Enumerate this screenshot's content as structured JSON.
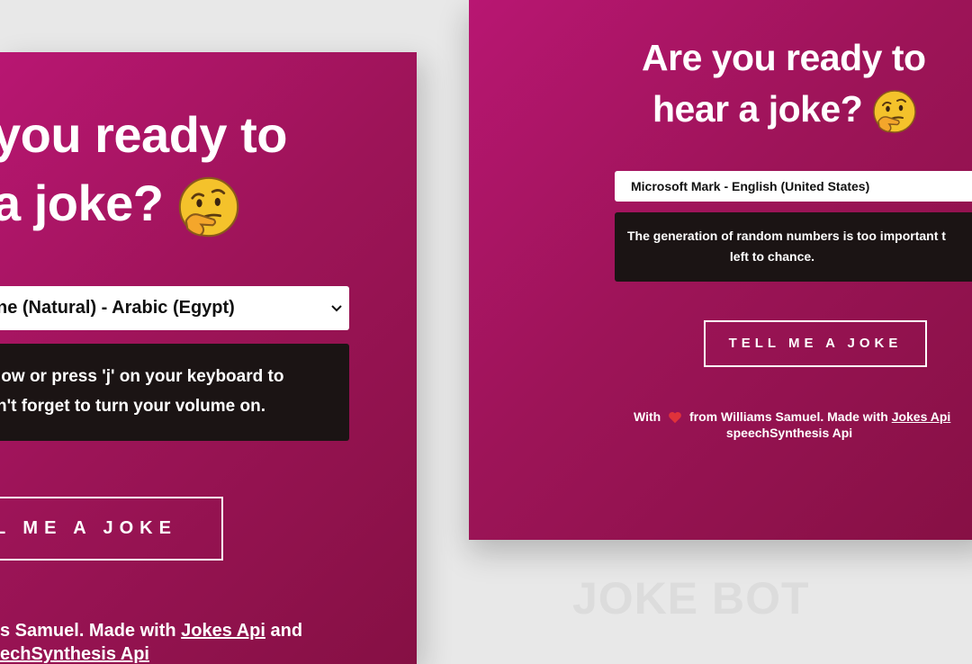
{
  "left_panel": {
    "title_line1": "you ready to",
    "title_line2": "a joke?",
    "voice_select": {
      "selected": "ne (Natural) - Arabic (Egypt)"
    },
    "message_line1": "low or press 'j' on your keyboard to",
    "message_line2": "n't forget to turn your volume on.",
    "button_label": "L ME A JOKE",
    "footer_line1_prefix": "s Samuel. Made with",
    "footer_link1": "Jokes Api",
    "footer_line1_suffix": "and",
    "footer_line2": "echSynthesis Api"
  },
  "right_panel": {
    "title_line1": "Are you ready to",
    "title_line2": "hear a joke?",
    "voice_select": {
      "selected": "Microsoft Mark - English (United States)"
    },
    "message_line1": "The generation of random numbers is too important t",
    "message_line2": "left to chance.",
    "button_label": "TELL ME A JOKE",
    "footer_with": "With",
    "footer_from": "from Williams Samuel. Made with",
    "footer_link1": "Jokes Api",
    "footer_line2": "speechSynthesis Api"
  },
  "watermark": "JOKE BOT",
  "colors": {
    "gradient_start": "#b81672",
    "gradient_end": "#861044",
    "message_bg": "#1b1414",
    "page_bg": "#e8e8e8"
  },
  "icons": {
    "title_emoji": "thinking-face-icon",
    "caret": "chevron-down-icon",
    "heart": "heart-icon"
  }
}
